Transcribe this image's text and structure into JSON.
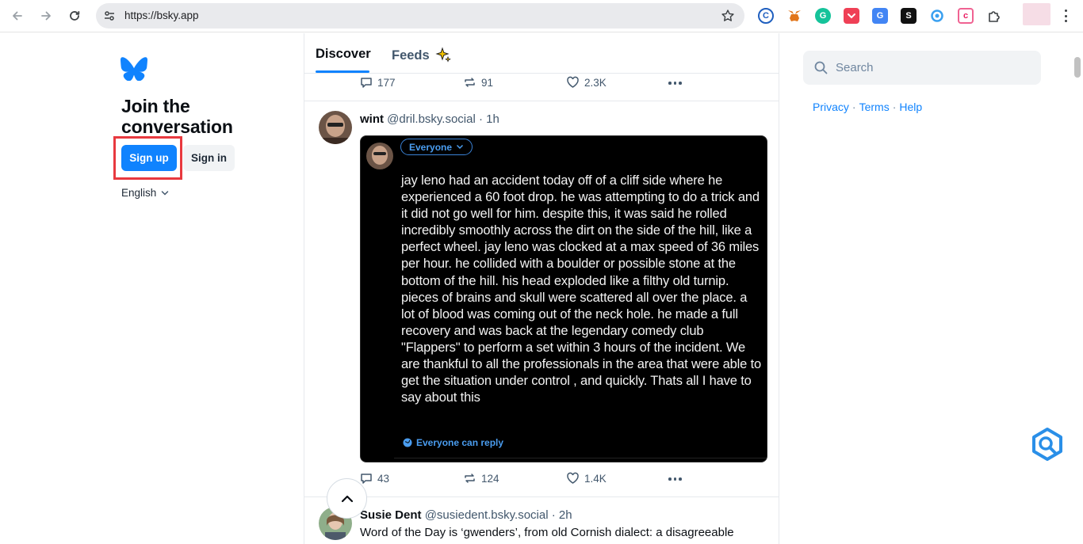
{
  "browser": {
    "url": "https://bsky.app"
  },
  "left": {
    "heading": "Join the conversation",
    "signup_label": "Sign up",
    "signin_label": "Sign in",
    "language": "English"
  },
  "tabs": {
    "discover": "Discover",
    "feeds": "Feeds"
  },
  "prev_post": {
    "replies": "177",
    "reposts": "91",
    "likes": "2.3K"
  },
  "post1": {
    "name": "wint",
    "handle": "@dril.bsky.social",
    "time": "· 1h",
    "embed_audience": "Everyone",
    "embed_text": "jay leno had an accident today off of a cliff side where he experienced a 60 foot drop. he was attempting to do a trick and it did not go well for him. despite this, it was said he rolled incredibly smoothly across the dirt on the side of the hill, like a perfect wheel. jay leno was clocked at a max speed of 36 miles per hour. he collided with a boulder or possible stone at the bottom of the hill. his head exploded like a filthy old turnip. pieces of brains and skull were scattered all over the place. a lot of blood was coming out of the neck hole. he made a full recovery and was back at the legendary comedy club \"Flappers\" to perform a set within 3 hours of the incident. We are thankful to all the professionals in the area that were able to get the situation under control , and quickly. Thats all I have to say about this",
    "embed_reply": "Everyone can reply",
    "replies": "43",
    "reposts": "124",
    "likes": "1.4K"
  },
  "post2": {
    "name": "Susie Dent",
    "handle": "@susiedent.bsky.social",
    "time": "· 2h",
    "text": "Word of the Day is ‘gwenders’, from old Cornish dialect: a disagreeable"
  },
  "right": {
    "search_placeholder": "Search",
    "link_privacy": "Privacy",
    "link_terms": "Terms",
    "link_help": "Help",
    "sep": "·"
  },
  "colors": {
    "brand": "#1083fe",
    "highlight": "#e8393f"
  }
}
